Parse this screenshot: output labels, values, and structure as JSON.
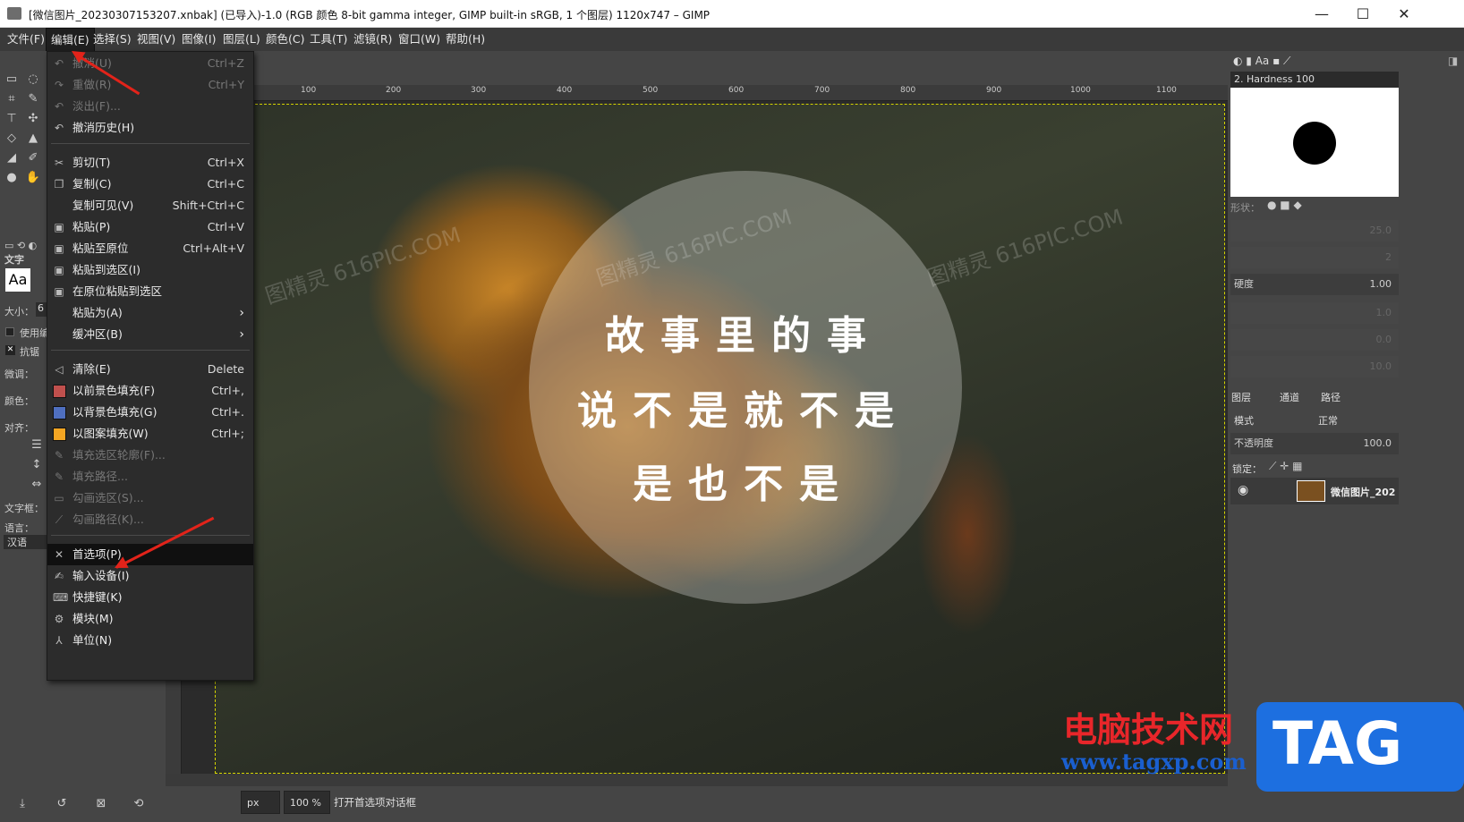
{
  "window": {
    "title": "[微信图片_20230307153207.xnbak] (已导入)-1.0 (RGB 颜色 8-bit gamma integer, GIMP built-in sRGB, 1 个图层) 1120x747 – GIMP",
    "minimize": "—",
    "maximize": "☐",
    "close": "✕"
  },
  "menubar": [
    "文件(F)",
    "编辑(E)",
    "选择(S)",
    "视图(V)",
    "图像(I)",
    "图层(L)",
    "颜色(C)",
    "工具(T)",
    "滤镜(R)",
    "窗口(W)",
    "帮助(H)"
  ],
  "edit_menu": {
    "undo": {
      "label": "撤消(U)",
      "key": "Ctrl+Z"
    },
    "redo": {
      "label": "重做(R)",
      "key": "Ctrl+Y"
    },
    "fade": {
      "label": "淡出(F)..."
    },
    "undo_history": {
      "label": "撤消历史(H)"
    },
    "cut": {
      "label": "剪切(T)",
      "key": "Ctrl+X"
    },
    "copy": {
      "label": "复制(C)",
      "key": "Ctrl+C"
    },
    "copy_visible": {
      "label": "复制可见(V)",
      "key": "Shift+Ctrl+C"
    },
    "paste": {
      "label": "粘贴(P)",
      "key": "Ctrl+V"
    },
    "paste_in_place": {
      "label": "粘贴至原位",
      "key": "Ctrl+Alt+V"
    },
    "paste_into_selection": {
      "label": "粘贴到选区(I)"
    },
    "paste_into_selection_in_place": {
      "label": "在原位粘贴到选区"
    },
    "paste_as": {
      "label": "粘贴为(A)"
    },
    "buffer": {
      "label": "缓冲区(B)"
    },
    "clear": {
      "label": "清除(E)",
      "key": "Delete"
    },
    "fill_fg": {
      "label": "以前景色填充(F)",
      "key": "Ctrl+,"
    },
    "fill_bg": {
      "label": "以背景色填充(G)",
      "key": "Ctrl+."
    },
    "fill_pattern": {
      "label": "以图案填充(W)",
      "key": "Ctrl+;"
    },
    "fill_selection_outline": {
      "label": "填充选区轮廓(F)..."
    },
    "fill_path": {
      "label": "填充路径..."
    },
    "stroke_selection": {
      "label": "勾画选区(S)..."
    },
    "stroke_path": {
      "label": "勾画路径(K)..."
    },
    "preferences": {
      "label": "首选项(P)"
    },
    "input_devices": {
      "label": "输入设备(I)"
    },
    "keyboard_shortcuts": {
      "label": "快捷键(K)"
    },
    "modules": {
      "label": "模块(M)"
    },
    "units": {
      "label": "单位(N)"
    }
  },
  "tool_options": {
    "title": "文字",
    "font_preview": "Aa",
    "size_label": "大小：",
    "size_value": "6",
    "use_editor": "使用编",
    "antialias": "抗锯",
    "hinting": "微调：",
    "color": "颜色：",
    "justify": "对齐：",
    "textbox": "文字框：",
    "language": "语言：",
    "language_value": "汉语"
  },
  "ruler": [
    "100",
    "200",
    "300",
    "400",
    "500",
    "600",
    "700",
    "800",
    "900",
    "1000",
    "1100"
  ],
  "image_text": {
    "line1": "故事里的事",
    "line2": "说不是就不是",
    "line3": "是也不是",
    "watermark": "图精灵 616PIC.COM"
  },
  "status": {
    "unit": "px",
    "zoom": "100 %",
    "message": "打开首选项对话框"
  },
  "brushes": {
    "selected": "2. Hardness 100",
    "shape_label": "形状：",
    "hardness_label": "硬度",
    "hardness_value": "1.00",
    "radius_value": "25.0",
    "spikes_value": "2",
    "aspect_value": "1.0",
    "angle_value": "0.0",
    "spacing_value": "10.0"
  },
  "layers": {
    "tab_layers": "图层",
    "tab_channels": "通道",
    "tab_paths": "路径",
    "mode_label": "模式",
    "mode_value": "正常",
    "opacity_label": "不透明度",
    "opacity_value": "100.0",
    "lock_label": "锁定：",
    "layer_name": "微信图片_202"
  },
  "branding": {
    "site_name": "电脑技术网",
    "site_url": "www.tagxp.com",
    "tag": "TAG"
  },
  "colors": {
    "accent_red": "#e2231a",
    "fg_swatch": "#c0504d",
    "bg_swatch": "#4f6fbf",
    "pattern_swatch": "#f5a623"
  }
}
